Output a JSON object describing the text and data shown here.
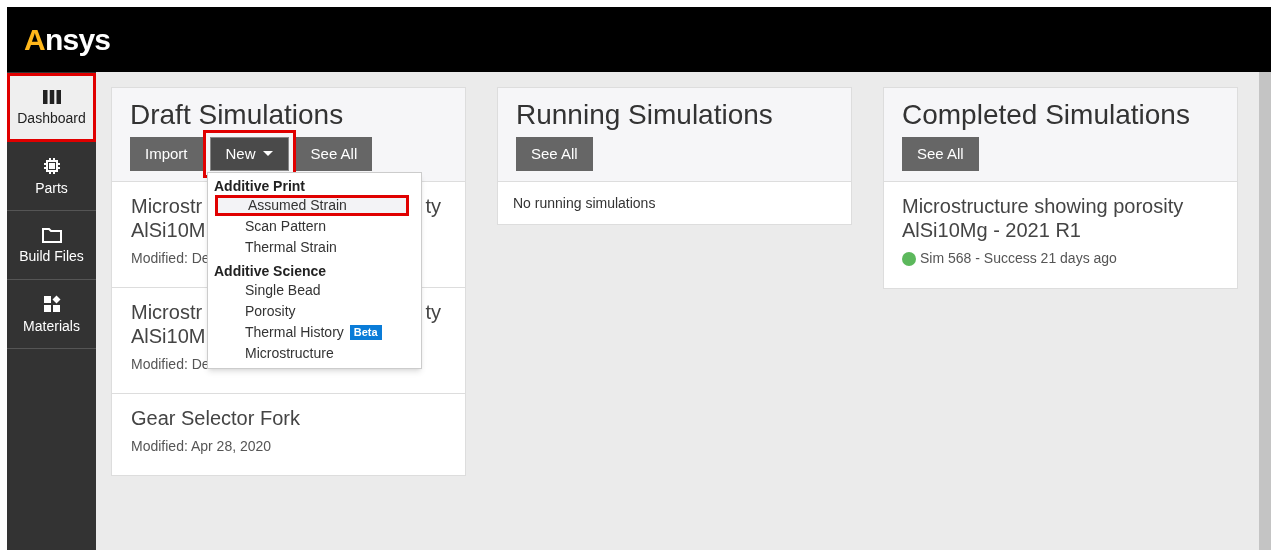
{
  "header": {
    "logo": "Ansys"
  },
  "sidebar": {
    "items": [
      {
        "label": "Dashboard",
        "kind": "columns",
        "selected": true,
        "highlighted": true
      },
      {
        "label": "Parts",
        "kind": "chip",
        "selected": false,
        "highlighted": false
      },
      {
        "label": "Build Files",
        "kind": "folder",
        "selected": false,
        "highlighted": false
      },
      {
        "label": "Materials",
        "kind": "shapes",
        "selected": false,
        "highlighted": false
      }
    ]
  },
  "panels": [
    {
      "title": "Draft Simulations",
      "buttons": [
        {
          "label": "Import",
          "kind": "plain"
        },
        {
          "label": "New",
          "kind": "dropdown",
          "highlighted": true
        },
        {
          "label": "See All",
          "kind": "plain"
        }
      ],
      "items": [
        {
          "kind": "covered",
          "title_start": "Microstr",
          "title_end": "ty",
          "title_line_2": "AlSi10M",
          "modified": "Modified: De"
        },
        {
          "kind": "covered",
          "title_start": "Microstr",
          "title_end": "ty",
          "title_line_2": "AlSi10M",
          "modified": "Modified: De"
        },
        {
          "kind": "full",
          "title": "Gear Selector Fork",
          "modified": "Modified: Apr 28, 2020"
        }
      ]
    },
    {
      "title": "Running Simulations",
      "buttons": [
        {
          "label": "See All",
          "kind": "plain"
        }
      ],
      "empty_text": "No running simulations"
    },
    {
      "title": "Completed Simulations",
      "buttons": [
        {
          "label": "See All",
          "kind": "plain"
        }
      ],
      "items": [
        {
          "kind": "status",
          "title": "Microstructure showing porosity AlSi10Mg - 2021 R1",
          "status": "Sim 568 - Success 21 days ago",
          "color": "#5cb85c"
        }
      ]
    }
  ],
  "new_menu": {
    "groups": [
      {
        "heading": "Additive Print",
        "items": [
          {
            "label": "Assumed Strain",
            "highlighted": true
          },
          {
            "label": "Scan Pattern",
            "highlighted": false
          },
          {
            "label": "Thermal Strain",
            "highlighted": false
          }
        ]
      },
      {
        "heading": "Additive Science",
        "items": [
          {
            "label": "Single Bead",
            "highlighted": false
          },
          {
            "label": "Porosity",
            "highlighted": false
          },
          {
            "label": "Thermal History",
            "badge": "Beta",
            "highlighted": false
          },
          {
            "label": "Microstructure",
            "highlighted": false
          }
        ]
      }
    ]
  }
}
